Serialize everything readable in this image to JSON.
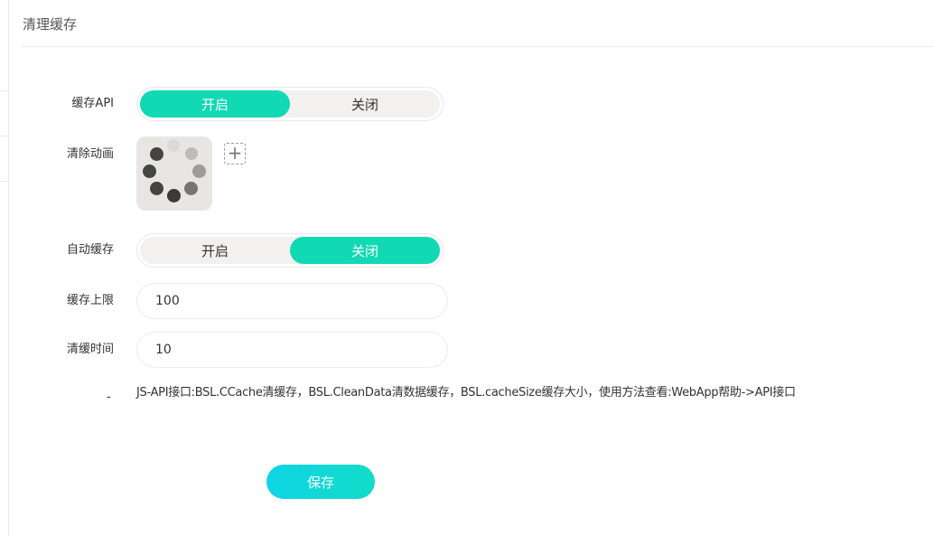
{
  "page": {
    "title": "清理缓存"
  },
  "form": {
    "cache_api": {
      "label": "缓存API",
      "options": [
        "开启",
        "关闭"
      ],
      "selected": "开启"
    },
    "clear_animation": {
      "label": "清除动画",
      "add_icon": "plus-icon"
    },
    "auto_cache": {
      "label": "自动缓存",
      "options": [
        "开启",
        "关闭"
      ],
      "selected": "关闭"
    },
    "cache_limit": {
      "label": "缓存上限",
      "value": "100"
    },
    "clear_time": {
      "label": "清缓时间",
      "value": "10"
    },
    "hint": {
      "label": "-",
      "text": "JS-API接口:BSL.CCache清缓存，BSL.CleanData清数据缓存，BSL.cacheSize缓存大小，使用方法查看:WebApp帮助->API接口"
    }
  },
  "actions": {
    "save_label": "保存"
  },
  "colors": {
    "accent": "#10d9b4",
    "button_gradient_start": "#0fd4e6",
    "button_gradient_end": "#13dcc7"
  }
}
